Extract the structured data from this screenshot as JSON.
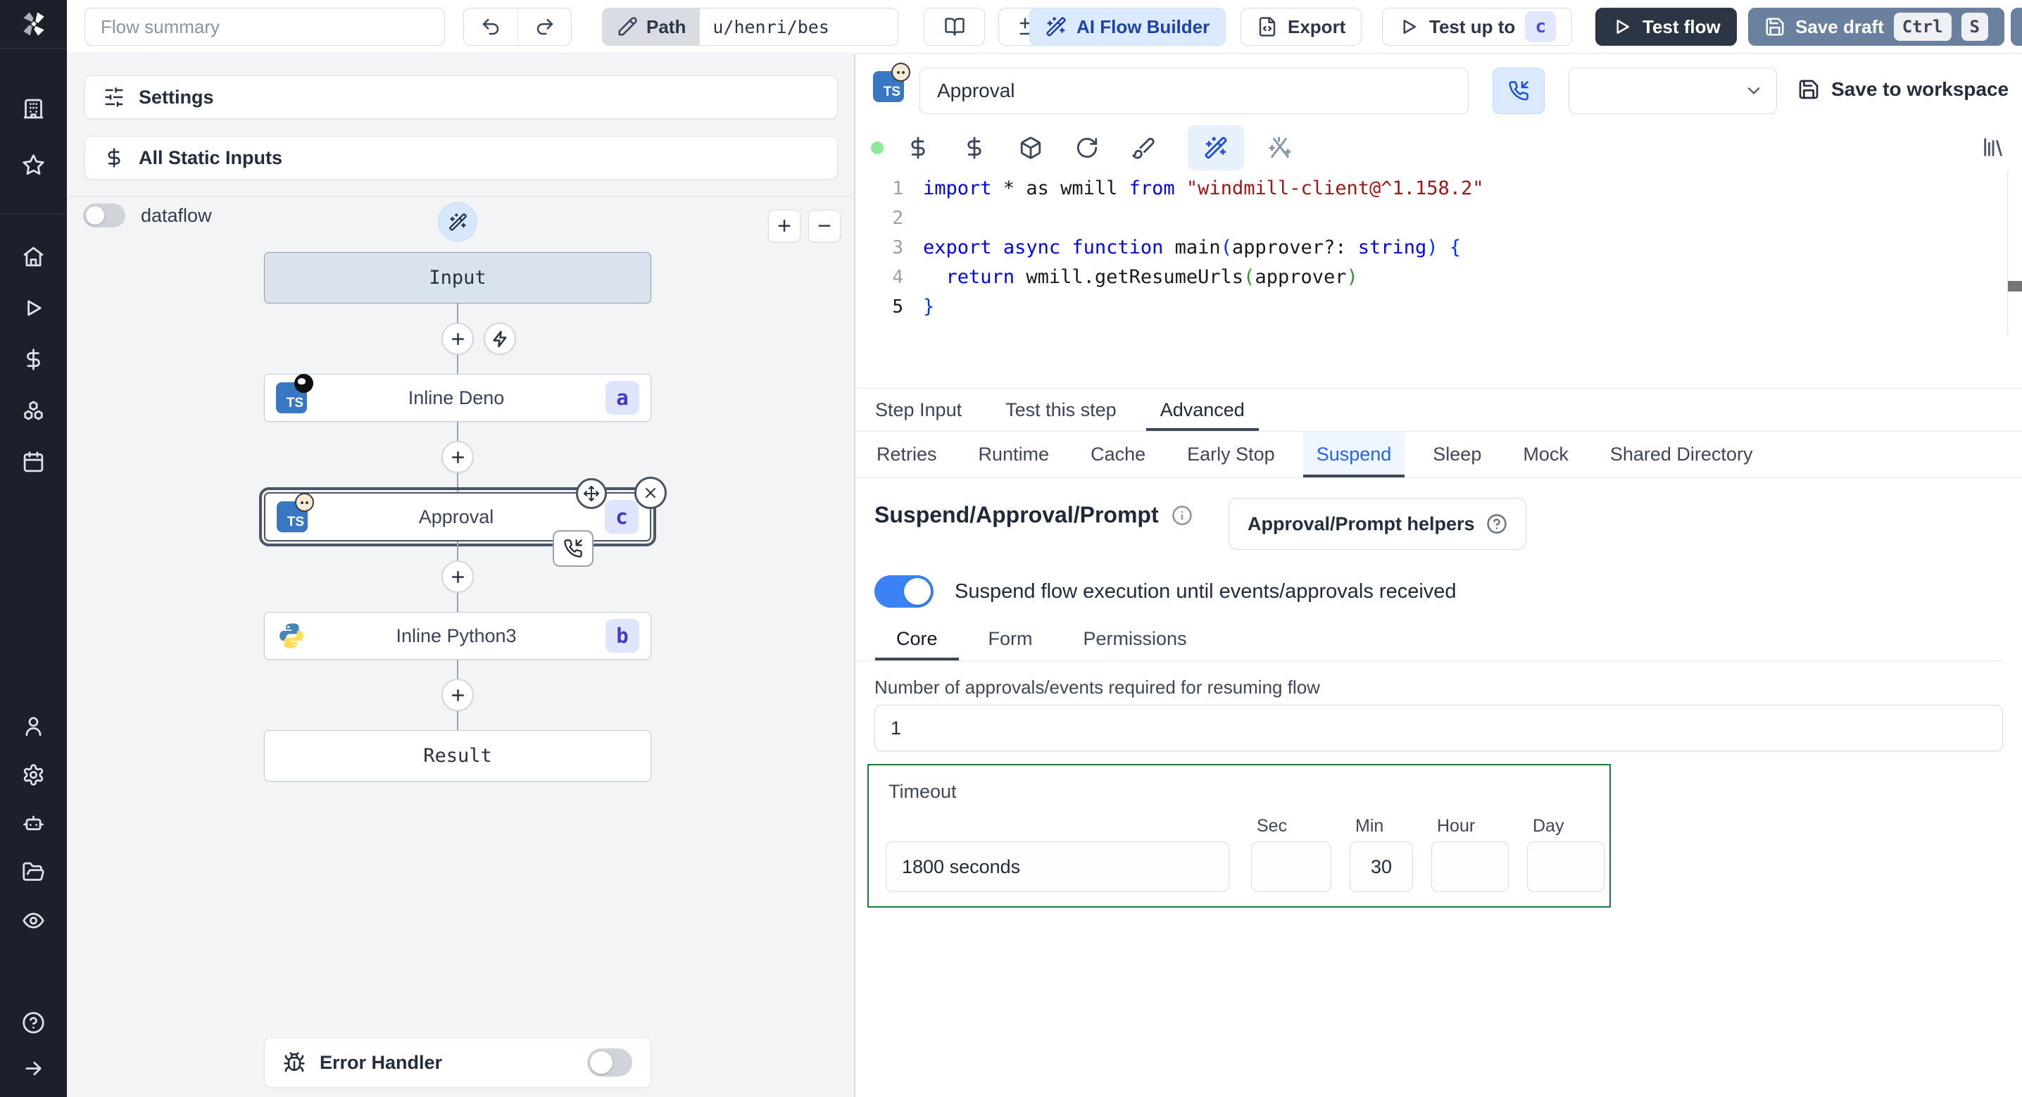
{
  "sidebar": {
    "top": [
      "building",
      "star"
    ],
    "mid": [
      "home",
      "play",
      "dollar",
      "boxes",
      "calendar"
    ],
    "lower": [
      "user",
      "settings",
      "bot",
      "folder",
      "eye"
    ],
    "foot": [
      "help",
      "collapse"
    ]
  },
  "toolbar": {
    "flow_summary_placeholder": "Flow summary",
    "path_label": "Path",
    "path_value": "u/henri/bes",
    "diff_label": "Diff",
    "ai_builder_label": "AI Flow Builder",
    "export_label": "Export",
    "test_up_to_label": "Test up to",
    "test_up_to_badge": "c",
    "test_flow_label": "Test flow",
    "save_draft_label": "Save draft",
    "kbd_ctrl": "Ctrl",
    "kbd_s": "S"
  },
  "flow_panel": {
    "settings_label": "Settings",
    "static_inputs_label": "All Static Inputs",
    "dataflow_label": "dataflow",
    "error_handler_label": "Error Handler"
  },
  "graph": {
    "input_label": "Input",
    "result_label": "Result",
    "steps": [
      {
        "title": "Inline Deno",
        "badge": "a",
        "icon": "deno",
        "selected": false
      },
      {
        "title": "Approval",
        "badge": "c",
        "icon": "bun",
        "selected": true
      },
      {
        "title": "Inline Python3",
        "badge": "b",
        "icon": "python",
        "selected": false
      }
    ]
  },
  "editor": {
    "step_name": "Approval",
    "language_badge": "TS",
    "save_to_workspace_label": "Save to workspace",
    "toolbar_icons": [
      {
        "name": "dollar"
      },
      {
        "name": "dollar"
      },
      {
        "name": "package"
      },
      {
        "name": "refresh"
      },
      {
        "name": "brush"
      },
      {
        "name": "wand",
        "active": true
      },
      {
        "name": "sparkles",
        "dim": true
      }
    ],
    "active_line": 5,
    "code_lines": [
      [
        [
          "kw",
          "import"
        ],
        [
          "pl",
          " * as wmill "
        ],
        [
          "kw",
          "from"
        ],
        [
          "pl",
          " "
        ],
        [
          "str",
          "\"windmill-client@^1.158.2\""
        ]
      ],
      [],
      [
        [
          "kw",
          "export"
        ],
        [
          "pl",
          " "
        ],
        [
          "kw",
          "async"
        ],
        [
          "pl",
          " "
        ],
        [
          "kw",
          "function"
        ],
        [
          "pl",
          " main"
        ],
        [
          "p1",
          "("
        ],
        [
          "pl",
          "approver?: "
        ],
        [
          "kw",
          "string"
        ],
        [
          "p1",
          ")"
        ],
        [
          "pl",
          " "
        ],
        [
          "p1",
          "{"
        ]
      ],
      [
        [
          "pl",
          "  "
        ],
        [
          "kw",
          "return"
        ],
        [
          "pl",
          " wmill.getResumeUrls"
        ],
        [
          "p2",
          "("
        ],
        [
          "pl",
          "approver"
        ],
        [
          "p2",
          ")"
        ]
      ],
      [
        [
          "p1",
          "}"
        ]
      ]
    ]
  },
  "tabs": {
    "main": [
      {
        "label": "Step Input"
      },
      {
        "label": "Test this step"
      },
      {
        "label": "Advanced",
        "active": true
      }
    ],
    "advanced": [
      {
        "label": "Retries"
      },
      {
        "label": "Runtime"
      },
      {
        "label": "Cache"
      },
      {
        "label": "Early Stop"
      },
      {
        "label": "Suspend",
        "active": true
      },
      {
        "label": "Sleep"
      },
      {
        "label": "Mock"
      },
      {
        "label": "Shared Directory"
      }
    ]
  },
  "suspend": {
    "heading": "Suspend/Approval/Prompt",
    "helpers_label": "Approval/Prompt helpers",
    "toggle_label": "Suspend flow execution until events/approvals received",
    "toggle_on": true,
    "tabs": [
      {
        "label": "Core",
        "active": true
      },
      {
        "label": "Form"
      },
      {
        "label": "Permissions"
      }
    ],
    "approvals_label": "Number of approvals/events required for resuming flow",
    "approvals_value": "1"
  },
  "timeout": {
    "label": "Timeout",
    "duration_value": "1800 seconds",
    "units": [
      {
        "label": "Sec",
        "value": "",
        "width": 114
      },
      {
        "label": "Min",
        "value": "30",
        "width": 90
      },
      {
        "label": "Hour",
        "value": "",
        "width": 110
      },
      {
        "label": "Day",
        "value": "",
        "width": 110
      }
    ]
  },
  "colors": {
    "accent": "#3b82f6",
    "timeout_border": "#15803d",
    "ai_builder_bg": "#dbeafe",
    "ai_builder_text": "#1e40af",
    "save_draft_bg": "#69809f",
    "test_flow_bg": "#2b3544",
    "badge_bg": "#e0e7ff",
    "badge_text": "#4338ca",
    "status_dot": "#8ce99a"
  }
}
